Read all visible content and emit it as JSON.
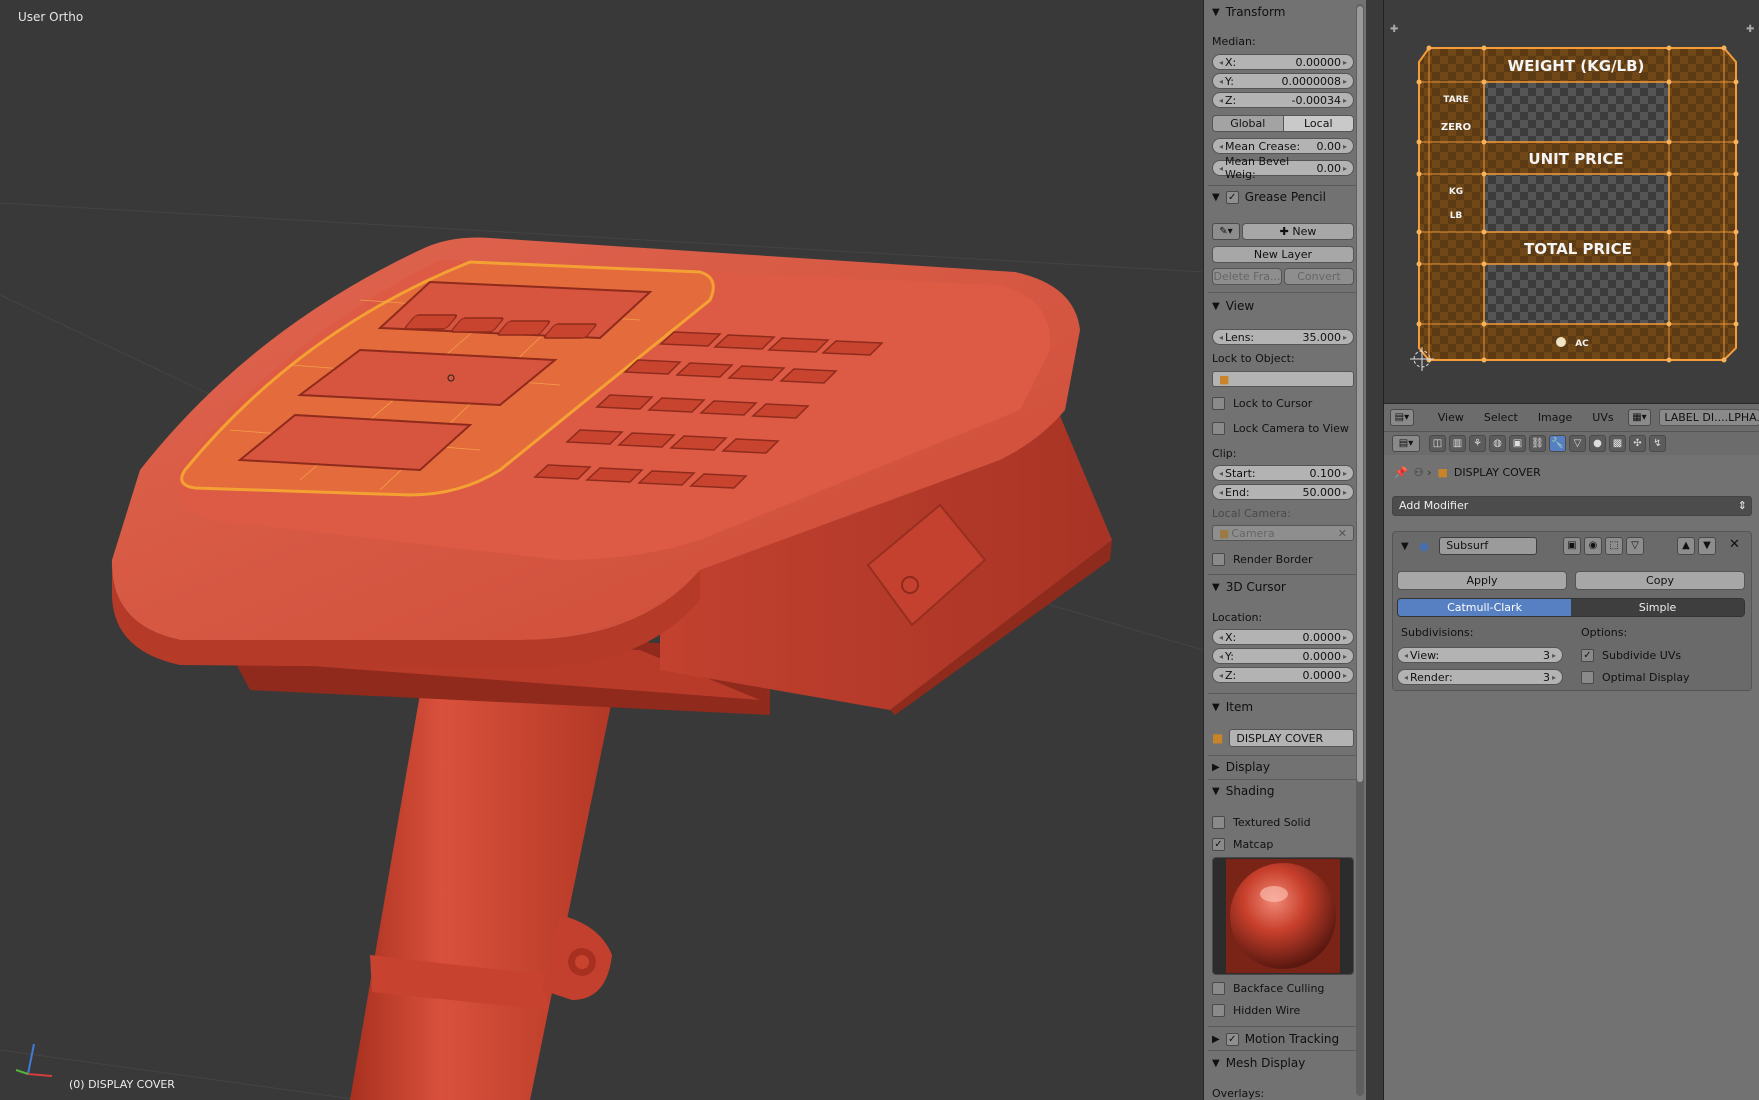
{
  "viewport": {
    "title": "User Ortho",
    "active_object": "(0) DISPLAY COVER"
  },
  "npanel": {
    "transform": {
      "header": "Transform",
      "median_label": "Median:",
      "x_label": "X:",
      "x_value": "0.00000",
      "y_label": "Y:",
      "y_value": "0.0000008",
      "z_label": "Z:",
      "z_value": "-0.00034",
      "global_label": "Global",
      "local_label": "Local",
      "crease_label": "Mean Crease:",
      "crease_value": "0.00",
      "bevel_label": "Mean Bevel Weig:",
      "bevel_value": "0.00"
    },
    "grease_pencil": {
      "header": "Grease Pencil",
      "new_label": "New",
      "new_layer_label": "New Layer",
      "delete_frame_label": "Delete Fra...",
      "convert_label": "Convert"
    },
    "view": {
      "header": "View",
      "lens_label": "Lens:",
      "lens_value": "35.000",
      "lock_object_label": "Lock to Object:",
      "lock_cursor_label": "Lock to Cursor",
      "lock_camera_label": "Lock Camera to View",
      "clip_label": "Clip:",
      "start_label": "Start:",
      "start_value": "0.100",
      "end_label": "End:",
      "end_value": "50.000",
      "local_camera_label": "Local Camera:",
      "camera_placeholder": "Camera",
      "render_border_label": "Render Border"
    },
    "cursor": {
      "header": "3D Cursor",
      "location_label": "Location:",
      "x_label": "X:",
      "x_value": "0.0000",
      "y_label": "Y:",
      "y_value": "0.0000",
      "z_label": "Z:",
      "z_value": "0.0000"
    },
    "item": {
      "header": "Item",
      "name": "DISPLAY COVER"
    },
    "display": {
      "header": "Display"
    },
    "shading": {
      "header": "Shading",
      "textured_solid_label": "Textured Solid",
      "matcap_label": "Matcap",
      "backface_label": "Backface Culling",
      "hidden_wire_label": "Hidden Wire"
    },
    "motion_tracking": {
      "header": "Motion Tracking"
    },
    "mesh_display": {
      "header": "Mesh Display",
      "overlays_label": "Overlays:"
    }
  },
  "uv_editor": {
    "labels": {
      "weight": "WEIGHT (KG/LB)",
      "tare": "TARE",
      "zero": "ZERO",
      "unit_price": "UNIT PRICE",
      "kg": "KG",
      "lb": "LB",
      "total_price": "TOTAL PRICE",
      "ac": "AC"
    },
    "menu": [
      "View",
      "Select",
      "Image",
      "UVs"
    ],
    "image_name": "LABEL DI....LPHA.png"
  },
  "modifiers": {
    "object_name": "DISPLAY COVER",
    "add_modifier_label": "Add Modifier",
    "modifier_name": "Subsurf",
    "apply_label": "Apply",
    "copy_label": "Copy",
    "catmull_label": "Catmull-Clark",
    "simple_label": "Simple",
    "subdivisions_label": "Subdivisions:",
    "view_label": "View:",
    "view_value": "3",
    "render_label": "Render:",
    "render_value": "3",
    "options_label": "Options:",
    "subdivide_uvs_label": "Subdivide UVs",
    "optimal_display_label": "Optimal Display"
  },
  "colors": {
    "model_red": "#d9503b",
    "selection_orange": "#f4a134",
    "active_blue": "#5680c2",
    "panel_grey": "#727272",
    "viewport_bg": "#393939"
  }
}
